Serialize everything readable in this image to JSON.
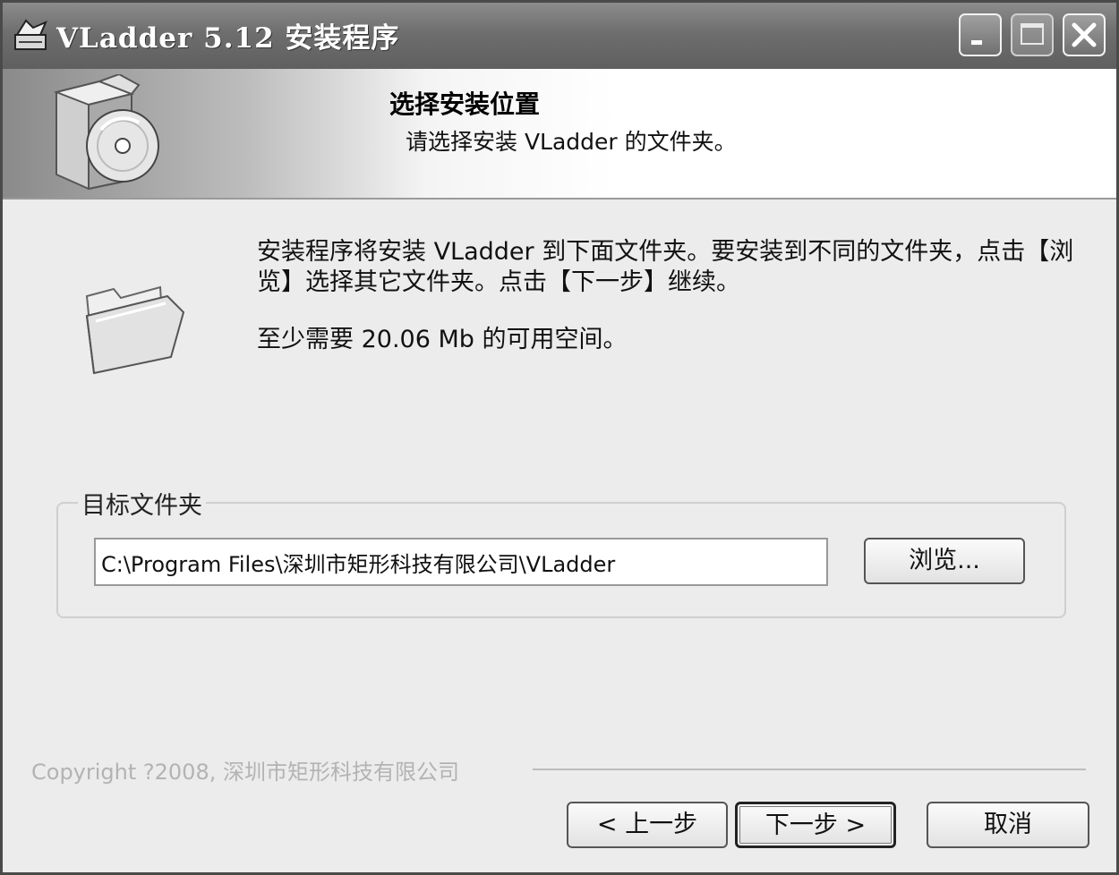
{
  "window": {
    "title": "VLadder 5.12 安装程序",
    "icon": "installer-app-icon"
  },
  "header": {
    "title": "选择安装位置",
    "subtitle": "请选择安装 VLadder 的文件夹。",
    "illustration": "installer-box-cd-icon"
  },
  "body": {
    "folder_icon": "folder-open-icon",
    "instructions": "安装程序将安装 VLadder 到下面文件夹。要安装到不同的文件夹，点击【浏览】选择其它文件夹。点击【下一步】继续。",
    "space_required": "至少需要 20.06 Mb 的可用空间。"
  },
  "destination": {
    "legend": "目标文件夹",
    "path_value": "C:\\Program Files\\深圳市矩形科技有限公司\\VLadder",
    "browse_label": "浏览..."
  },
  "footer": {
    "copyright": "Copyright ?2008, 深圳市矩形科技有限公司",
    "back_label": "< 上一步",
    "next_label": "下一步 >",
    "cancel_label": "取消"
  },
  "colors": {
    "titlebar": "#6e6e6e",
    "dialog_bg": "#ececec",
    "copyright_text": "#b3b3b3"
  }
}
